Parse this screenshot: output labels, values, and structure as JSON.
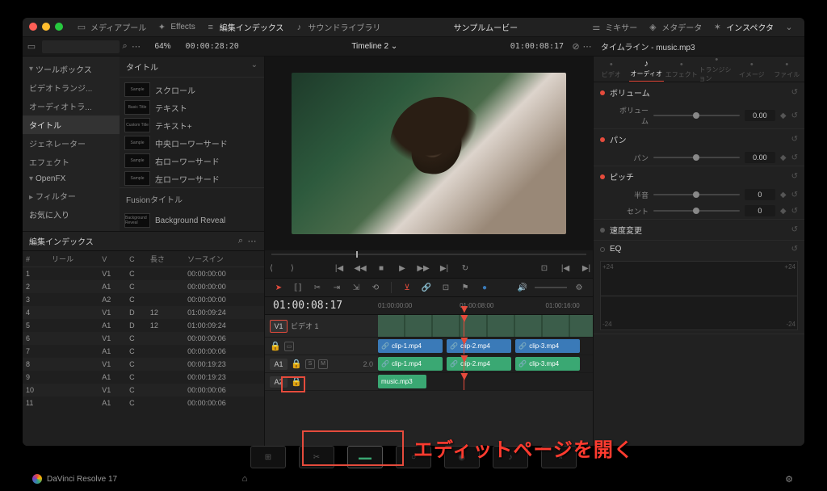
{
  "topbar": {
    "mediapool": "メディアプール",
    "effects": "Effects",
    "index": "編集インデックス",
    "soundlib": "サウンドライブラリ",
    "project": "サンプルムービー",
    "mixer": "ミキサー",
    "metadata": "メタデータ",
    "inspector": "インスペクタ"
  },
  "toolrow": {
    "zoom": "64%",
    "tc_left": "00:00:28:20",
    "timeline_name": "Timeline 2",
    "tc_right": "01:00:08:17"
  },
  "toolbox": {
    "header": "ツールボックス",
    "items": [
      "ビデオトランジ...",
      "オーディオトラ...",
      "タイトル",
      "ジェネレーター",
      "エフェクト"
    ],
    "selected": "タイトル",
    "openfx": "OpenFX",
    "filters": "フィルター",
    "fav": "お気に入り"
  },
  "titles": {
    "header": "タイトル",
    "items": [
      {
        "thumb": "Sample",
        "label": "スクロール"
      },
      {
        "thumb": "Basic Title",
        "label": "テキスト"
      },
      {
        "thumb": "Custom Title",
        "label": "テキスト+"
      },
      {
        "thumb": "Sample",
        "label": "中央ローワーサード"
      },
      {
        "thumb": "Sample",
        "label": "右ローワーサード"
      },
      {
        "thumb": "Sample",
        "label": "左ローワーサード"
      }
    ],
    "fusion": "Fusionタイトル",
    "fusion_item": {
      "thumb": "Background Reveal",
      "label": "Background Reveal"
    }
  },
  "index": {
    "header": "編集インデックス",
    "cols": [
      "#",
      "リール",
      "V",
      "C",
      "長さ",
      "ソースイン"
    ],
    "rows": [
      [
        "1",
        "",
        "V1",
        "C",
        "",
        "00:00:00:00"
      ],
      [
        "2",
        "",
        "A1",
        "C",
        "",
        "00:00:00:00"
      ],
      [
        "3",
        "",
        "A2",
        "C",
        "",
        "00:00:00:00"
      ],
      [
        "4",
        "",
        "V1",
        "D",
        "12",
        "01:00:09:24"
      ],
      [
        "5",
        "",
        "A1",
        "D",
        "12",
        "01:00:09:24"
      ],
      [
        "6",
        "",
        "V1",
        "C",
        "",
        "00:00:00:06"
      ],
      [
        "7",
        "",
        "A1",
        "C",
        "",
        "00:00:00:06"
      ],
      [
        "8",
        "",
        "V1",
        "C",
        "",
        "00:00:19:23"
      ],
      [
        "9",
        "",
        "A1",
        "C",
        "",
        "00:00:19:23"
      ],
      [
        "10",
        "",
        "V1",
        "C",
        "",
        "00:00:00:06"
      ],
      [
        "11",
        "",
        "A1",
        "C",
        "",
        "00:00:00:06"
      ]
    ]
  },
  "inspector": {
    "clip": "タイムライン - music.mp3",
    "tabs": [
      "ビデオ",
      "オーディオ",
      "エフェクト",
      "トランジション",
      "イメージ",
      "ファイル"
    ],
    "tab_active": "オーディオ",
    "groups": {
      "volume": {
        "label": "ボリューム",
        "param": "ボリューム",
        "val": "0.00"
      },
      "pan": {
        "label": "パン",
        "param": "パン",
        "val": "0.00"
      },
      "pitch": {
        "label": "ピッチ",
        "semi": "半音",
        "semi_val": "0",
        "cent": "セント",
        "cent_val": "0"
      },
      "speed": {
        "label": "速度変更"
      },
      "eq": {
        "label": "EQ",
        "lo": "+24",
        "hi": "-24"
      }
    }
  },
  "timeline": {
    "bigtc": "01:00:08:17",
    "ruler": [
      "01:00:00:00",
      "01:00:08:00",
      "01:00:16:00"
    ],
    "thumb_label": "ビデオ 1",
    "v1": "V1",
    "a1": "A1",
    "a2": "A2",
    "clips_v": [
      "clip-1.mp4",
      "clip-2.mp4",
      "clip-3.mp4"
    ],
    "clips_a": [
      "clip-1.mp4",
      "clip-2.mp4",
      "clip-3.mp4"
    ],
    "music": "music.mp3",
    "track_opts": [
      "S",
      "M"
    ],
    "gain": "2.0"
  },
  "annotation": "エディットページを開く",
  "status": "DaVinci Resolve 17"
}
